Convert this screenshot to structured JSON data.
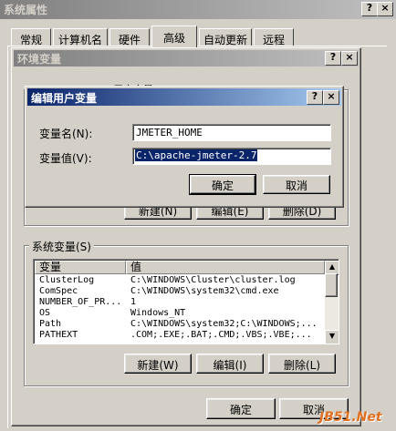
{
  "sys_props": {
    "title": "系统属性",
    "help": "?",
    "close": "×",
    "tabs": [
      {
        "label": "常规"
      },
      {
        "label": "计算机名"
      },
      {
        "label": "硬件"
      },
      {
        "label": "高级"
      },
      {
        "label": "自动更新"
      },
      {
        "label": "远程"
      }
    ]
  },
  "env_vars": {
    "title": "环境变量",
    "help": "?",
    "close": "×",
    "user_section_partial": "…用户变量(…)",
    "user_buttons": {
      "new": "新建(N)",
      "edit": "编辑(E)",
      "delete": "删除(D)"
    },
    "system_section": "系统变量(S)",
    "columns": {
      "var": "变量",
      "value": "值"
    },
    "system_rows": [
      {
        "var": "ClusterLog",
        "value": "C:\\WINDOWS\\Cluster\\cluster.log"
      },
      {
        "var": "ComSpec",
        "value": "C:\\WINDOWS\\system32\\cmd.exe"
      },
      {
        "var": "NUMBER_OF_PR...",
        "value": "1"
      },
      {
        "var": "OS",
        "value": "Windows_NT"
      },
      {
        "var": "Path",
        "value": "C:\\WINDOWS\\system32;C:\\WINDOWS;..."
      },
      {
        "var": "PATHEXT",
        "value": ".COM;.EXE;.BAT;.CMD;.VBS;.VBE;..."
      }
    ],
    "system_buttons": {
      "new": "新建(W)",
      "edit": "编辑(I)",
      "delete": "删除(L)"
    },
    "ok": "确定",
    "cancel": "取消"
  },
  "edit_dialog": {
    "title": "编辑用户变量",
    "help": "?",
    "close": "×",
    "name_label": "变量名(N):",
    "name_value": "JMETER_HOME",
    "value_label": "变量值(V):",
    "value_value": "C:\\apache-jmeter-2.7",
    "ok": "确定",
    "cancel": "取消"
  },
  "watermark": "JB51.Net"
}
